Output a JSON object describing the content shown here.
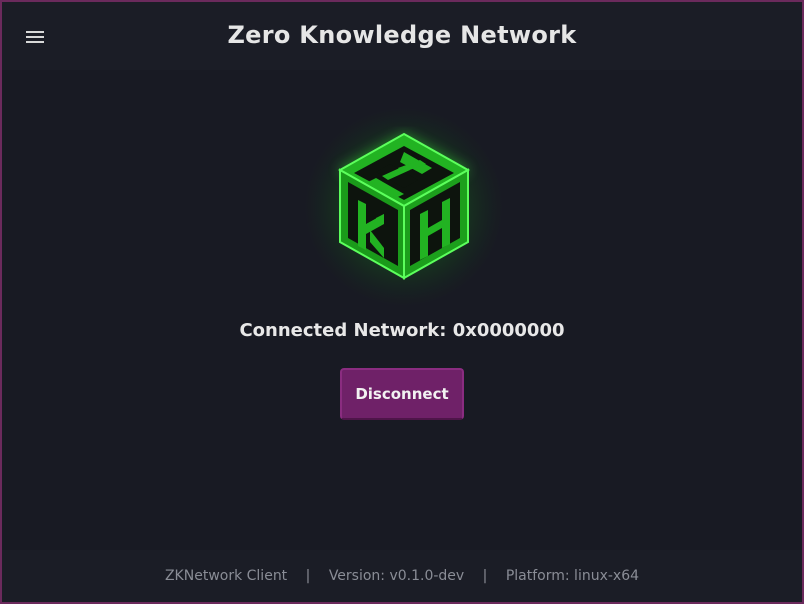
{
  "header": {
    "menu_icon": "hamburger-menu-icon",
    "title": "Zero Knowledge Network"
  },
  "main": {
    "logo_icon": "zkn-cube-logo-icon",
    "logo_letters": [
      "Z",
      "K",
      "N"
    ],
    "status": "Connected Network: 0x0000000",
    "disconnect_label": "Disconnect"
  },
  "footer": {
    "client": "ZKNetwork Client",
    "separator": "|",
    "version": "Version: v0.1.0-dev",
    "platform": "Platform: linux-x64"
  },
  "colors": {
    "window_border": "#6b2a5c",
    "background": "#181a23",
    "header_bg": "#1b1d26",
    "logo_green": "#1ed81e",
    "button_bg": "#6f2168",
    "footer_text": "#8a8d96"
  }
}
